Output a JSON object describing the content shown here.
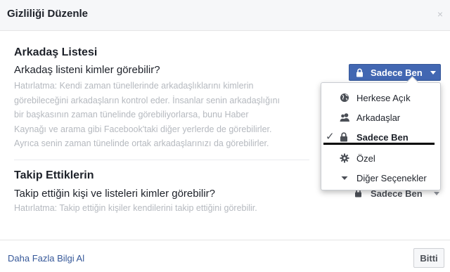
{
  "dialog": {
    "title": "Gizliliği Düzenle",
    "close_symbol": "×"
  },
  "friends_section": {
    "title": "Arkadaş Listesi",
    "question": "Arkadaş listeni kimler görebilir?",
    "hint_lines": [
      "Hatırlatma: Kendi zaman tünellerinde arkadaşlıklarını kimlerin",
      "görebileceğini arkadaşların kontrol eder. İnsanlar senin arkadaşlığını",
      "bir başkasının zaman tünelinde görebiliyorlarsa, bunu Haber",
      "Kaynağı ve arama gibi Facebook'taki diğer yerlerde de görebilirler.",
      "Ayrıca senin zaman tünelinde ortak arkadaşlarınızı da görebilirler."
    ],
    "privacy_label": "Sadece Ben",
    "privacy_icon": "lock-icon"
  },
  "following_section": {
    "title": "Takip Ettiklerin",
    "question": "Takip ettiğin kişi ve listeleri kimler görebilir?",
    "hint": "Hatırlatma: Takip ettiğin kişiler kendilerini takip ettiğini görebilir.",
    "privacy_label": "Sadece Ben",
    "privacy_icon": "lock-icon"
  },
  "privacy_menu": {
    "items": [
      {
        "label": "Herkese Açık",
        "icon": "globe-icon",
        "selected": false
      },
      {
        "label": "Arkadaşlar",
        "icon": "friends-icon",
        "selected": false
      },
      {
        "label": "Sadece Ben",
        "icon": "lock-icon",
        "selected": true
      },
      {
        "label": "Özel",
        "icon": "gear-icon",
        "selected": false
      },
      {
        "label": "Diğer Seçenekler",
        "icon": "caret-down-icon",
        "selected": false
      }
    ],
    "check_symbol": "✓"
  },
  "footer": {
    "more_info_link": "Daha Fazla Bilgi Al",
    "done_button": "Bitti"
  },
  "colors": {
    "accent": "#4267b2",
    "link": "#365899",
    "hint_text": "#b5b9bf",
    "header_bg": "#f6f7f9"
  }
}
